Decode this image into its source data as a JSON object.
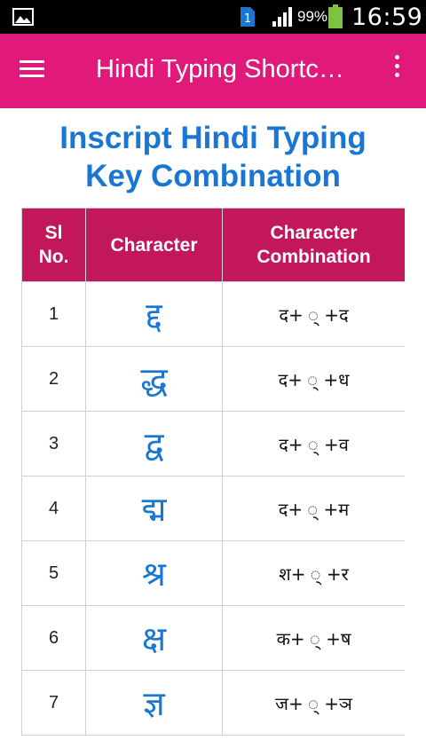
{
  "status_bar": {
    "battery_percent": "99%",
    "time": "16:59",
    "sim_label": "1",
    "icons": [
      "gallery-icon",
      "sim-icon",
      "signal-icon",
      "battery-icon"
    ]
  },
  "app_bar": {
    "title": "Hindi Typing Shortc…",
    "background": "#e0197a",
    "icons": [
      "menu-icon",
      "overflow-menu-icon"
    ]
  },
  "heading": {
    "line1": "Inscript Hindi Typing",
    "line2": "Key Combination",
    "color": "#1976d2"
  },
  "table": {
    "header_color": "#c2185b",
    "headers": {
      "sl": "Sl No.",
      "character": "Character",
      "combination": "Character Combination"
    },
    "rows": [
      {
        "sl": "1",
        "character": "द्द",
        "combination": "द+ ् +द"
      },
      {
        "sl": "2",
        "character": "द्ध",
        "combination": "द+ ् +ध"
      },
      {
        "sl": "3",
        "character": "द्व",
        "combination": "द+ ् +व"
      },
      {
        "sl": "4",
        "character": "द्म",
        "combination": "द+ ् +म"
      },
      {
        "sl": "5",
        "character": "श्र",
        "combination": "श+ ् +र"
      },
      {
        "sl": "6",
        "character": "क्ष",
        "combination": "क+ ् +ष"
      },
      {
        "sl": "7",
        "character": "ज्ञ",
        "combination": "ज+ ् +ञ"
      }
    ]
  }
}
